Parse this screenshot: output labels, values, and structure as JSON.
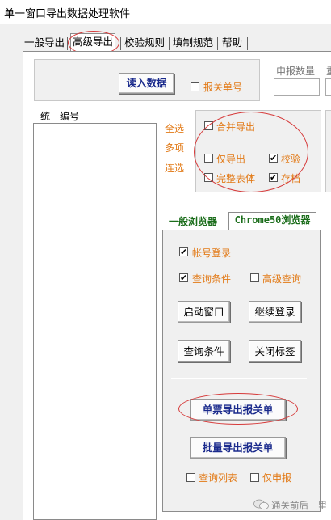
{
  "window": {
    "title": "单一窗口导出数据处理软件"
  },
  "tabs": [
    "一般导出",
    "高级导出",
    "校验规则",
    "填制规范",
    "帮助"
  ],
  "top": {
    "read_button": "读入数据",
    "customs_no_label": "报关单号",
    "declare_count_label": "申报数量",
    "cut_label": "重"
  },
  "list": {
    "header": "统一编号",
    "links": [
      "全选",
      "多项",
      "连选"
    ]
  },
  "options": {
    "merge_export": {
      "label": "合并导出",
      "checked": false
    },
    "only_export": {
      "label": "仅导出",
      "checked": false
    },
    "verify": {
      "label": "校验",
      "checked": true
    },
    "full_table": {
      "label": "完整表体",
      "checked": false
    },
    "archive": {
      "label": "存档",
      "checked": true
    }
  },
  "browser_tabs": [
    "一般浏览器",
    "Chrome50浏览器"
  ],
  "browser": {
    "account_login": {
      "label": "帐号登录",
      "checked": true
    },
    "query_conditions_chk": {
      "label": "查询条件",
      "checked": true
    },
    "advanced_query": {
      "label": "高级查询",
      "checked": false
    },
    "start_window": "启动窗口",
    "continue_login": "继续登录",
    "query_conditions_btn": "查询条件",
    "close_tabs": "关闭标签",
    "single_export": "单票导出报关单",
    "batch_export": "批量导出报关单",
    "query_list": {
      "label": "查询列表",
      "checked": false
    },
    "only_declare": {
      "label": "仅申报",
      "checked": false
    }
  },
  "watermark": {
    "text": "通关前后一里"
  },
  "colors": {
    "highlight": "#d63a3a",
    "accent_orange": "#e27a17",
    "button_text": "#1a2a8c",
    "tab_green": "#1b6d1b"
  }
}
